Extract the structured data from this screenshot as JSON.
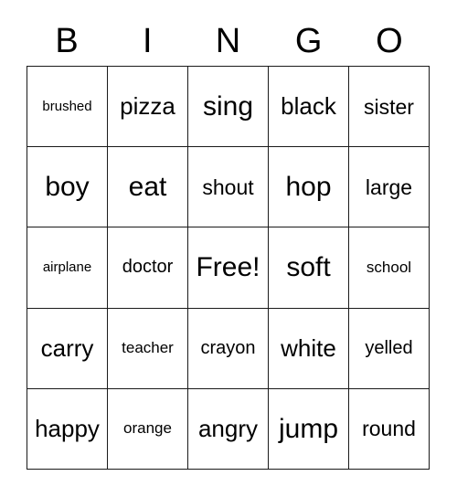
{
  "header": {
    "letters": [
      "B",
      "I",
      "N",
      "G",
      "O"
    ]
  },
  "grid": {
    "rows": 5,
    "columns": 5,
    "free_space_label": "Free!",
    "cells": [
      [
        {
          "text": "brushed",
          "size": "fs-xs"
        },
        {
          "text": "pizza",
          "size": "fs-xl"
        },
        {
          "text": "sing",
          "size": "fs-xxl"
        },
        {
          "text": "black",
          "size": "fs-xl"
        },
        {
          "text": "sister",
          "size": "fs-l"
        }
      ],
      [
        {
          "text": "boy",
          "size": "fs-xxl"
        },
        {
          "text": "eat",
          "size": "fs-xxl"
        },
        {
          "text": "shout",
          "size": "fs-l"
        },
        {
          "text": "hop",
          "size": "fs-xxl"
        },
        {
          "text": "large",
          "size": "fs-l"
        }
      ],
      [
        {
          "text": "airplane",
          "size": "fs-xs"
        },
        {
          "text": "doctor",
          "size": "fs-m"
        },
        {
          "text": "Free!",
          "size": "fs-xxl"
        },
        {
          "text": "soft",
          "size": "fs-xxl"
        },
        {
          "text": "school",
          "size": "fs-s"
        }
      ],
      [
        {
          "text": "carry",
          "size": "fs-xl"
        },
        {
          "text": "teacher",
          "size": "fs-s"
        },
        {
          "text": "crayon",
          "size": "fs-m"
        },
        {
          "text": "white",
          "size": "fs-xl"
        },
        {
          "text": "yelled",
          "size": "fs-m"
        }
      ],
      [
        {
          "text": "happy",
          "size": "fs-xl"
        },
        {
          "text": "orange",
          "size": "fs-s"
        },
        {
          "text": "angry",
          "size": "fs-xl"
        },
        {
          "text": "jump",
          "size": "fs-xxl"
        },
        {
          "text": "round",
          "size": "fs-l"
        }
      ]
    ]
  },
  "colors": {
    "background": "#ffffff",
    "text": "#000000",
    "border": "#1a1a1a"
  }
}
